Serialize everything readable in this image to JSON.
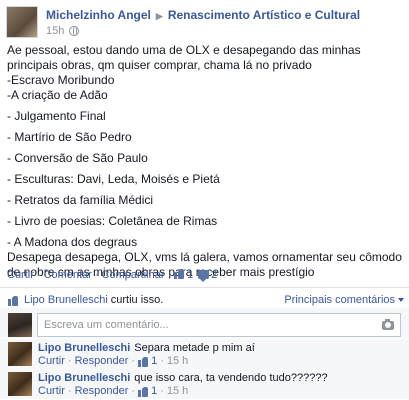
{
  "post": {
    "author": "Michelzinho Angel",
    "arrow": "▶",
    "group": "Renascimento Artístico e Cultural",
    "time": "15h",
    "lines": [
      "Ae pessoal, estou dando uma de OLX e desapegando das minhas principais obras, qm quiser comprar, chama lá no privado",
      "-Escravo Moribundo",
      "-A criação de Adão",
      "- Julgamento Final",
      "- Martírio de São Pedro",
      "- Conversão de São Paulo",
      "- Esculturas: Davi, Leda, Moisés e Pietá",
      "- Retratos da família Médici",
      "- Livro de poesias: Coletânea de Rimas",
      "- A Madona dos degraus",
      "Desapega desapega, OLX, vms lá galera, vamos ornamentar seu cômodo de nobre cm as minhas obras para receber mais prestígio"
    ]
  },
  "actions": {
    "like": "Curtir",
    "comment": "Comentar",
    "share": "Compartilhar",
    "like_count": "1",
    "comment_count": "2",
    "separator": "·"
  },
  "likes": {
    "who": "Lipo Brunelleschi",
    "rest": "curtiu isso.",
    "sort_label": "Principais comentários"
  },
  "comment_box": {
    "placeholder": "Escreva um comentário..."
  },
  "comments": [
    {
      "author": "Lipo Brunelleschi",
      "text": "Separa metade p mim aí",
      "like": "Curtir",
      "reply": "Responder",
      "likes": "1",
      "time": "15 h"
    },
    {
      "author": "Lipo Brunelleschi",
      "text": "que isso cara, ta vendendo tudo??????",
      "like": "Curtir",
      "reply": "Responder",
      "likes": "1",
      "time": "15 h"
    }
  ]
}
